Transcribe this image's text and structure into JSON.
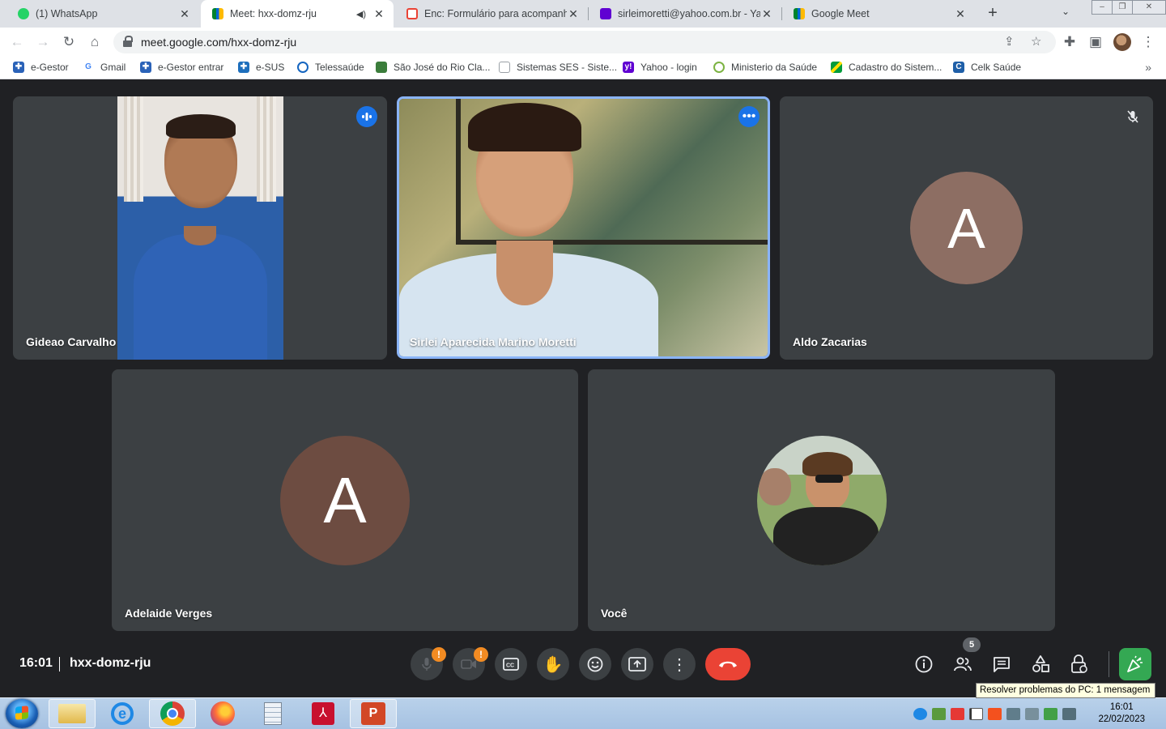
{
  "browser": {
    "tabs": [
      {
        "title": "(1) WhatsApp",
        "active": false,
        "favicon": "whatsapp-icon"
      },
      {
        "title": "Meet: hxx-domz-rju",
        "active": true,
        "favicon": "meet-icon"
      },
      {
        "title": "Enc: Formulário para acompanha",
        "active": false,
        "favicon": "gmail-icon"
      },
      {
        "title": "sirleimoretti@yahoo.com.br - Yah",
        "active": false,
        "favicon": "yahoo-mail-icon"
      },
      {
        "title": "Google Meet",
        "active": false,
        "favicon": "meet-icon"
      }
    ],
    "url": "meet.google.com/hxx-domz-rju",
    "bookmarks": [
      {
        "label": "e-Gestor",
        "icon": "egestor-icon"
      },
      {
        "label": "Gmail",
        "icon": "google-icon"
      },
      {
        "label": "e-Gestor entrar",
        "icon": "egestor-icon"
      },
      {
        "label": "e-SUS",
        "icon": "esus-icon"
      },
      {
        "label": "Telessaúde",
        "icon": "telessaude-icon"
      },
      {
        "label": "São José do Rio Cla...",
        "icon": "city-crest-icon"
      },
      {
        "label": "Sistemas SES - Siste...",
        "icon": "document-icon"
      },
      {
        "label": "Yahoo - login",
        "icon": "yahoo-icon"
      },
      {
        "label": "Ministerio da Saúde",
        "icon": "ministry-icon"
      },
      {
        "label": "Cadastro do Sistem...",
        "icon": "brazil-flag-icon"
      },
      {
        "label": "Celk Saúde",
        "icon": "celk-icon"
      }
    ]
  },
  "meet": {
    "participants": [
      {
        "name": "Gideao Carvalho",
        "video": true,
        "status": "speaking"
      },
      {
        "name": "Sirlei Aparecida Marino Moretti",
        "video": true,
        "status": "more-options",
        "pinned_highlight": true
      },
      {
        "name": "Aldo Zacarias",
        "video": false,
        "initial": "A",
        "avatar_color": "#8d6e63",
        "status": "muted"
      },
      {
        "name": "Adelaide Verges",
        "video": false,
        "initial": "A",
        "avatar_color": "#6d4c41"
      },
      {
        "name": "Você",
        "video": false,
        "avatar": "profile-photo"
      }
    ],
    "clock": "16:01",
    "meeting_code": "hxx-domz-rju",
    "people_count": "5",
    "mic_warning": "!",
    "cam_warning": "!"
  },
  "tooltip": "Resolver problemas do PC: 1 mensagem",
  "taskbar": {
    "time": "16:01",
    "date": "22/02/2023"
  },
  "colors": {
    "meet_bg": "#202124",
    "tile_bg": "#3c4043",
    "accent_blue": "#1a73e8",
    "hangup_red": "#ea4335",
    "activities_green": "#34a853"
  }
}
